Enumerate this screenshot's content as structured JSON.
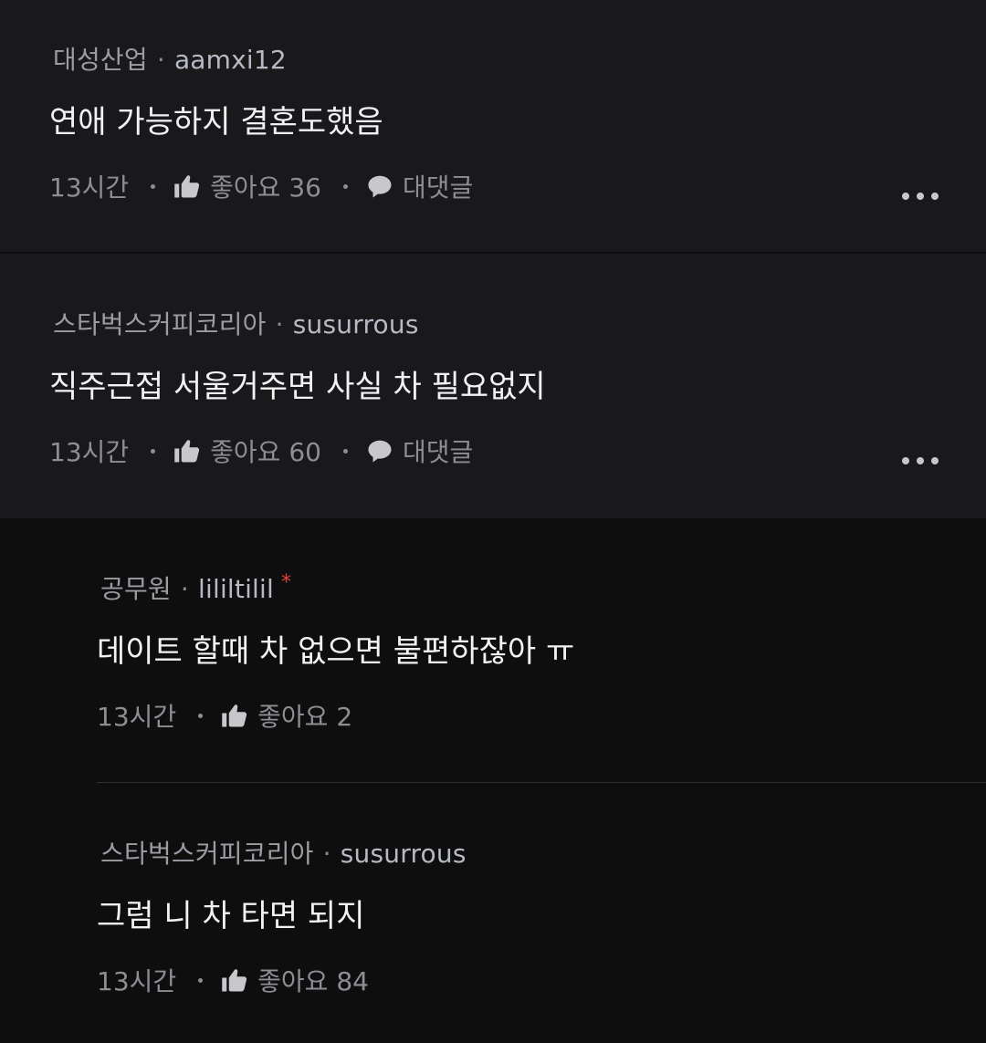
{
  "comments": [
    {
      "nickname": "대성산업",
      "separator": "·",
      "user_id": "aamxi12",
      "text": "연애 가능하지 결혼도했음",
      "time": "13시간",
      "like_label": "좋아요 36",
      "reply_label": "대댓글"
    },
    {
      "nickname": "스타벅스커피코리아",
      "separator": "·",
      "user_id": "susurrous",
      "text": "직주근접 서울거주면 사실 차 필요없지",
      "time": "13시간",
      "like_label": "좋아요 60",
      "reply_label": "대댓글"
    }
  ],
  "replies": [
    {
      "nickname": "공무원",
      "separator": "·",
      "user_id": "lililtilil",
      "badge": "*",
      "text": "데이트 할때 차 없으면 불편하잖아 ㅠ",
      "time": "13시간",
      "like_label": "좋아요 2"
    },
    {
      "nickname": "스타벅스커피코리아",
      "separator": "·",
      "user_id": "susurrous",
      "text": "그럼 니 차 타면 되지",
      "time": "13시간",
      "like_label": "좋아요 84"
    }
  ],
  "icons": {
    "like": "thumbs-up-icon",
    "reply": "speech-bubble-icon",
    "more": "more-horizontal-icon"
  },
  "colors": {
    "background": "#0f0f10",
    "card": "#19191b",
    "star": "#e0453a"
  }
}
